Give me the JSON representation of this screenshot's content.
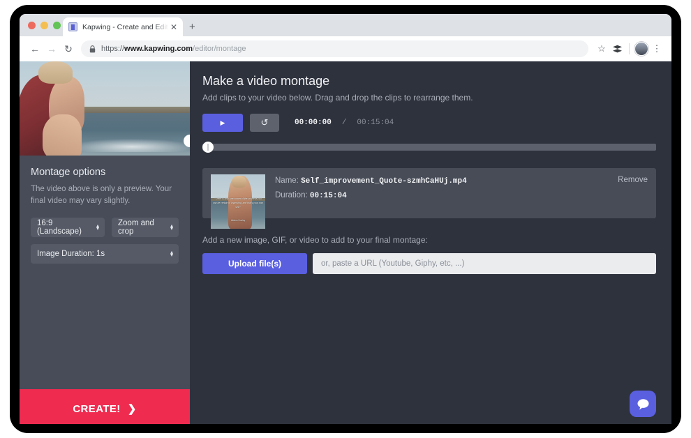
{
  "browser": {
    "tab_title": "Kapwing - Create and Edit Vid",
    "tab_close_glyph": "✕",
    "new_tab_glyph": "+",
    "back_glyph": "←",
    "forward_glyph": "→",
    "reload_glyph": "↻",
    "url_scheme": "https://",
    "url_domain": "www.kapwing.com",
    "url_path": "/editor/montage",
    "star_glyph": "☆",
    "extension_glyph": "≣",
    "menu_glyph": "⋮"
  },
  "sidebar": {
    "options_title": "Montage options",
    "options_description": "The video above is only a preview. Your final video may vary slightly.",
    "aspect_ratio": "16:9 (Landscape)",
    "crop_mode": "Zoom and crop",
    "image_duration": "Image Duration: 1s",
    "spinner_up": "▴",
    "spinner_down": "▾",
    "create_label": "CREATE!",
    "create_chevron": "❯"
  },
  "main": {
    "title": "Make a video montage",
    "subtitle": "Add clips to your video below. Drag and drop the clips to rearrange them.",
    "play_glyph": "▶",
    "restart_glyph": "↺",
    "time_current": "00:00:00",
    "time_separator": "/",
    "time_total": "00:15:04"
  },
  "clip": {
    "name_label": "Name:",
    "name_value": "Self_improvement_Quote-szmhCaHUj.mp4",
    "duration_label": "Duration:",
    "duration_value": "00:15:04",
    "remove_label": "Remove",
    "thumbnail_quote": "“There is only one corner of the universe you can be certain of improving, and that's your own self.”",
    "thumbnail_author": "Aldous Huxley"
  },
  "upload": {
    "section_label": "Add a new image, GIF, or video to add to your final montage:",
    "button_label": "Upload file(s)",
    "url_placeholder": "or, paste a URL (Youtube, Giphy, etc, ...)",
    "url_value": ""
  },
  "chat": {
    "bubble_glyph": "💬"
  },
  "colors": {
    "sidebar_bg": "#474c58",
    "main_bg": "#2e323d",
    "card_bg": "#474c57",
    "accent_purple": "#5a5fe0",
    "create_red": "#ef2b50",
    "input_bg": "#ebecee"
  }
}
